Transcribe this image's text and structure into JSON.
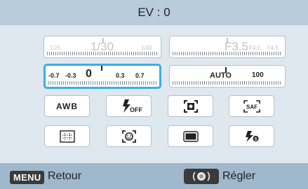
{
  "header": {
    "title": "EV : 0"
  },
  "shutter": {
    "min": "1/25",
    "current": "1/30",
    "max": "1/40"
  },
  "aperture": {
    "current": "F3.5",
    "next": "F4.0",
    "next2": "F4.5"
  },
  "ev": {
    "values": [
      "-0.7",
      "-0.3",
      "0",
      "0.3",
      "0.7"
    ]
  },
  "iso": {
    "mode": "AUTO",
    "value": "100"
  },
  "buttons": {
    "white_balance": "AWB",
    "flash_off": "OFF",
    "icons": [
      "awb-icon",
      "flash-off-icon",
      "metering-icon",
      "smart-af-icon",
      "grid-icon",
      "face-detect-icon",
      "display-icon",
      "flash-icon"
    ]
  },
  "footer": {
    "menu_key": "MENU",
    "menu_label": "Retour",
    "dial_label": "Régler"
  },
  "colors": {
    "accent": "#35b0e4",
    "header": "#b8ccdc",
    "footer": "#9fb8cc",
    "background": "#dfe7ef"
  }
}
